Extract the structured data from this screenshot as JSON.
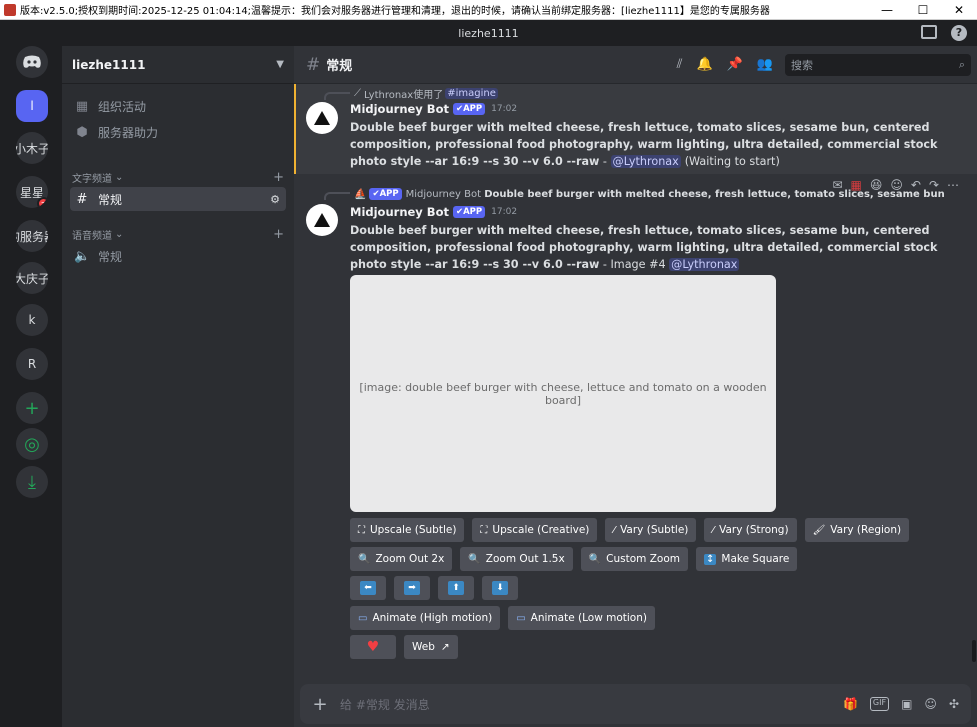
{
  "titlebar": {
    "text": "版本:v2.5.0;授权到期时间:2025-12-25 01:04:14;温馨提示：我们会对服务器进行管理和清理，退出的时候，请确认当前绑定服务器：[liezhe1111】是您的专属服务器",
    "min": "—",
    "max": "☐",
    "close": "✕"
  },
  "topbar": {
    "title": "liezhe1111",
    "inbox_icon": "inbox-icon",
    "help_icon": "help-icon",
    "help": "?"
  },
  "guilds": [
    {
      "label": "",
      "icon": "discord-icon"
    },
    {
      "label": "l"
    },
    {
      "label": "小木子"
    },
    {
      "label": "星星",
      "badge": "2"
    },
    {
      "label": "的服务器"
    },
    {
      "label": "大庆子"
    },
    {
      "label": "k"
    },
    {
      "label": "R"
    },
    {
      "label": "+",
      "icon": "add-server-icon"
    },
    {
      "label": "◎",
      "icon": "explore-icon"
    },
    {
      "label": "⤓",
      "icon": "download-icon"
    }
  ],
  "sidebar": {
    "server_name": "liezhe1111",
    "items": [
      {
        "label": "组织活动",
        "icon": "▦"
      },
      {
        "label": "服务器助力",
        "icon": "⬢"
      }
    ],
    "text_category": "文字频道",
    "voice_category": "语音频道",
    "text_channel": "常规",
    "voice_channel": "常规"
  },
  "header": {
    "channel": "常规",
    "search_placeholder": "搜索"
  },
  "messages": [
    {
      "reply_user": "Lythronax使用了",
      "reply_cmd": "imagine",
      "author": "Midjourney Bot",
      "tag": "APP",
      "time": "17:02",
      "text": "Double beef burger with melted cheese, fresh lettuce, tomato slices, sesame bun, centered composition, professional food photography, warm lighting, ultra detailed, commercial stock photo style --ar 16:9 --s 30 --v 6.0 --raw",
      "sep": " - ",
      "mention": "@Lythronax",
      "status": "(Waiting to start)"
    },
    {
      "reply_tag": "APP",
      "reply_user": "Midjourney Bot",
      "reply_text": "Double beef burger with melted cheese, fresh lettuce, tomato slices, sesame bun, centered c...",
      "author": "Midjourney Bot",
      "tag": "APP",
      "time": "17:02",
      "text": "Double beef burger with melted cheese, fresh lettuce, tomato slices, sesame bun, centered composition, professional food photography, warm lighting, ultra detailed, commercial stock photo style --ar 16:9 --s 30 --v 6.0 --raw",
      "sep": " - Image #4 ",
      "mention": "@Lythronax",
      "image_alt": "[image: double beef burger with cheese, lettuce and tomato on a wooden board]"
    }
  ],
  "buttons": {
    "row1": [
      "Upscale (Subtle)",
      "Upscale (Creative)",
      "Vary (Subtle)",
      "Vary (Strong)",
      "Vary (Region)"
    ],
    "row2": [
      "Zoom Out 2x",
      "Zoom Out 1.5x",
      "Custom Zoom",
      "Make Square"
    ],
    "row3": [
      "⬅",
      "➡",
      "⬆",
      "⬇"
    ],
    "row4": [
      "Animate (High motion)",
      "Animate (Low motion)"
    ],
    "row5_heart": "♥",
    "row5_web": "Web"
  },
  "composer": {
    "placeholder": "给 #常规 发消息"
  }
}
